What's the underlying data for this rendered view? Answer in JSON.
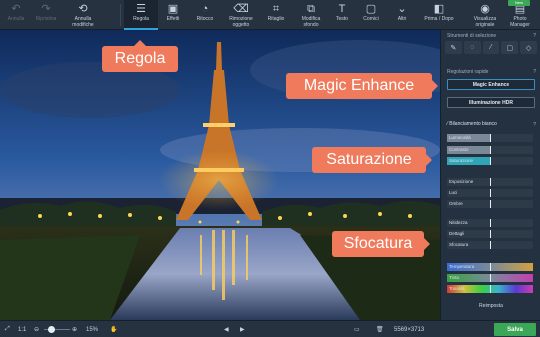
{
  "toolbar": {
    "items": [
      {
        "icon": "undo-icon",
        "glyph": "↶",
        "label": "Annulla"
      },
      {
        "icon": "redo-icon",
        "glyph": "↷",
        "label": "Ripristina"
      },
      {
        "icon": "undo-all-icon",
        "glyph": "⟲",
        "label": "Annulla\nmodifiche"
      },
      {
        "icon": "adjust-icon",
        "glyph": "☰",
        "label": "Regola"
      },
      {
        "icon": "effects-icon",
        "glyph": "▣",
        "label": "Effetti"
      },
      {
        "icon": "retouch-icon",
        "glyph": "◔",
        "label": "Ritocco"
      },
      {
        "icon": "object-removal-icon",
        "glyph": "⌫",
        "label": "Rimozione\noggetto"
      },
      {
        "icon": "crop-icon",
        "glyph": "⌗",
        "label": "Ritaglio"
      },
      {
        "icon": "background-icon",
        "glyph": "⧉",
        "label": "Modifica\nsfondo"
      },
      {
        "icon": "text-icon",
        "glyph": "T",
        "label": "Testo"
      },
      {
        "icon": "frame-icon",
        "glyph": "▢",
        "label": "Cornici"
      },
      {
        "icon": "more-icon",
        "glyph": "⌄",
        "label": "Altri"
      },
      {
        "icon": "before-after-icon",
        "glyph": "◧",
        "label": "Prima / Dopo"
      },
      {
        "icon": "eye-icon",
        "glyph": "◉",
        "label": "Visualizza\noriginale"
      },
      {
        "icon": "photo-manager-icon",
        "glyph": "▤",
        "label": "Photo\nManager"
      }
    ],
    "badge": "New"
  },
  "callouts": {
    "regola": "Regola",
    "magic": "Magic Enhance",
    "saturazione": "Saturazione",
    "sfocatura": "Sfocatura"
  },
  "panel": {
    "selection_title": "Strumenti di selezione",
    "quick_title": "Regolazioni rapide",
    "magic_button": "Magic Enhance",
    "hdr_button": "Illuminazione HDR",
    "wb_title": "Bilanciamento bianco",
    "help": "?",
    "sliders": [
      {
        "name": "Luminosità",
        "value": 0.5,
        "color": "#7b8896"
      },
      {
        "name": "Contrasto",
        "value": 0.5,
        "color": "#7b8896"
      },
      {
        "name": "Saturazione",
        "value": 0.5,
        "color": "#2fa6b8"
      },
      {
        "name": "Esposizione",
        "value": 0.5,
        "color": "#2d3a48"
      },
      {
        "name": "Luci",
        "value": 0.5,
        "color": "#2d3a48"
      },
      {
        "name": "Ombre",
        "value": 0.5,
        "color": "#2d3a48"
      },
      {
        "name": "Nitidezza",
        "value": 0.5,
        "color": "#2d3a48"
      },
      {
        "name": "Dettagli",
        "value": 0.5,
        "color": "#2d3a48"
      },
      {
        "name": "Sfocatura",
        "value": 0.5,
        "color": "#2d3a48"
      },
      {
        "name": "Temperatura",
        "value": 0.5,
        "color": "gradient-temp"
      },
      {
        "name": "Tinta",
        "value": 0.5,
        "color": "gradient-tint"
      },
      {
        "name": "Tonalità",
        "value": 0.5,
        "color": "gradient-hue"
      }
    ],
    "reset_button": "Reimposta"
  },
  "bottombar": {
    "fit_label": "1:1",
    "zoom_percent": "15%",
    "dimensions": "5569×3713",
    "save_button": "Salva"
  },
  "colors": {
    "accent": "#2ea3d8",
    "callout": "#ef7a5c",
    "save": "#3aa856"
  }
}
